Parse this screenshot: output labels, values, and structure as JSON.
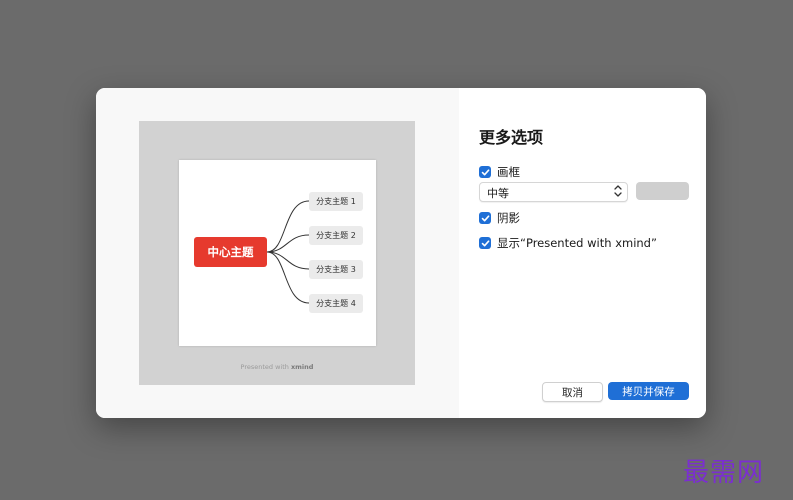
{
  "dialog": {
    "preview": {
      "central_topic": "中心主题",
      "branches": [
        "分支主题 1",
        "分支主题 2",
        "分支主题 3",
        "分支主题 4"
      ],
      "watermark_prefix": "Presented with ",
      "watermark_brand": "xmind"
    },
    "options": {
      "title": "更多选项",
      "frame_label": "画框",
      "frame_checked": true,
      "frame_size_value": "中等",
      "frame_color": "#cfcfcf",
      "shadow_label": "阴影",
      "shadow_checked": true,
      "show_watermark_label": "显示“Presented with xmind”",
      "show_watermark_checked": true
    },
    "buttons": {
      "cancel_label": "取消",
      "save_label": "拷贝并保存"
    }
  },
  "colors": {
    "accent": "#1f6fd6",
    "central_topic": "#e63a2e",
    "overlay": "#6b6b6b"
  },
  "site_watermark": "最需网"
}
